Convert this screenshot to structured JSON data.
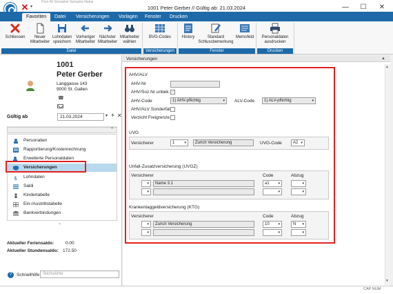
{
  "window": {
    "title": "1001 Peter Gerber // Gültig ab: 21.03.2024",
    "hidden_columns": "Pers-Nr   Gruname   Vorname   Name"
  },
  "menu": {
    "tabs": [
      "Favoriten",
      "Datei",
      "Versicherungen",
      "Vorlagen",
      "Fenster",
      "Drucken"
    ],
    "active": "Favoriten"
  },
  "ribbon": {
    "buttons": [
      {
        "label": "Schliessen",
        "icon": "close-x-icon"
      },
      {
        "label": "Neuer Mitarbeiter",
        "icon": "new-document-icon"
      },
      {
        "label": "Lohndaten speichern",
        "icon": "save-disk-icon"
      },
      {
        "label": "Vorheriger Mitarbeiter",
        "icon": "arrow-left-icon"
      },
      {
        "label": "Nächster Mitarbeiter",
        "icon": "arrow-right-icon"
      },
      {
        "label": "Mitarbeiter wählen",
        "icon": "binoculars-icon"
      },
      {
        "label": "BVG-Codes",
        "icon": "grid-icon"
      },
      {
        "label": "History",
        "icon": "history-icon"
      },
      {
        "label": "Standard Schlussbemerkung",
        "icon": "pen-icon"
      },
      {
        "label": "Memofeld",
        "icon": "memo-icon"
      },
      {
        "label": "Personaldaten ausdrucken",
        "icon": "printer-icon"
      }
    ],
    "groups": [
      "Datei",
      "Versicherungen",
      "Fenster",
      "Drucken"
    ]
  },
  "employee": {
    "number": "1001",
    "name": "Peter Gerber",
    "street": "Langgasse 143",
    "city": "9000 St. Gallen"
  },
  "validity": {
    "label": "Gültig ab",
    "value": "21.03.2024"
  },
  "nav": {
    "items": [
      {
        "label": "Personalien",
        "icon": "person-icon"
      },
      {
        "label": "Rapportierung/Kostenrechnung",
        "icon": "report-icon"
      },
      {
        "label": "Erweiterte Personaldaten",
        "icon": "person-plus-icon"
      },
      {
        "label": "Versicherungen",
        "icon": "shield-icon"
      },
      {
        "label": "Lohndaten",
        "icon": "money-icon"
      },
      {
        "label": "Saldi",
        "icon": "balance-icon"
      },
      {
        "label": "Kindertabelle",
        "icon": "child-icon"
      },
      {
        "label": "Ein-/Austrittstabelle",
        "icon": "table-icon"
      },
      {
        "label": "Bankverbindungen",
        "icon": "bank-icon"
      }
    ],
    "selected": "Versicherungen"
  },
  "balances": {
    "ferien_label": "Aktueller Feriensaldo:",
    "ferien_value": "0.00",
    "stunden_label": "Aktueller Stundensaldo:",
    "stunden_value": "172.50"
  },
  "help": {
    "label": "Schnellhilfe",
    "placeholder": "Stichwörter"
  },
  "form": {
    "title": "Versicherungen",
    "ahv": {
      "section": "AHV/ALV",
      "ahv_nr_label": "AHV-Nr",
      "ahv_nr_value": "",
      "soz_label": "AHV/Soz.Nr unbek.",
      "code_label": "AHV-Code",
      "code_value": "1) AHV-pflichtig",
      "alv_label": "ALV-Code",
      "alv_value": "1) ALV-pflichtig",
      "sonderfall_label": "AHV/ALV Sonderfall",
      "freigrenze_label": "Verzicht Freigrenze"
    },
    "uvg": {
      "section": "UVG",
      "versicherer_label": "Versicherer",
      "versicherer_code": "1",
      "versicherer_name": "Zurich Versicherung",
      "code_label": "UVG-Code",
      "code_value": "A2"
    },
    "uvgz": {
      "section": "Unfall-Zusatzversicherung (UVGZ)",
      "col_versicherer": "Versicherer",
      "col_code": "Code",
      "col_abzug": "Abzug",
      "row1_name": "Name 3.1",
      "row1_code": "a1"
    },
    "ktg": {
      "section": "Krankentaggeldversicherung (KTG)",
      "col_versicherer": "Versicherer",
      "col_code": "Code",
      "col_abzug": "Abzug",
      "row1_name": "Zurich Versicherung",
      "row1_code": "10",
      "row1_abzug": "N"
    }
  },
  "status": {
    "caps": "CAP NUM"
  }
}
